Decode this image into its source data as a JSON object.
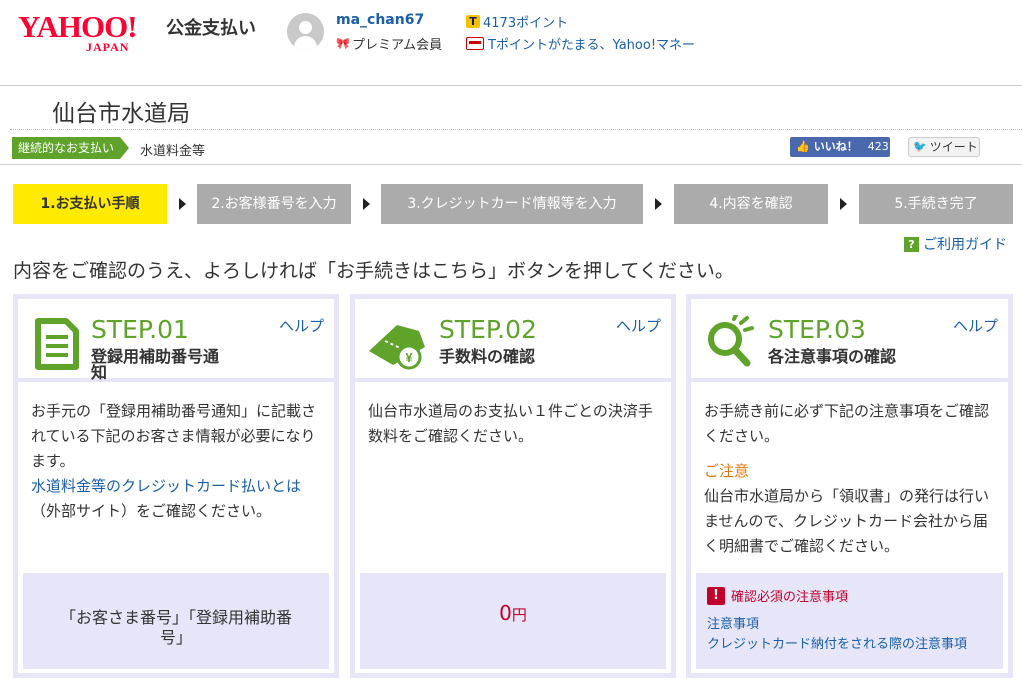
{
  "header": {
    "logo_text": "YAHOO!",
    "logo_sub": "JAPAN",
    "service_name": "公金支払い",
    "username": "ma_chan67",
    "membership": "プレミアム会員",
    "points": "4173ポイント",
    "tpoint_link": "Tポイントがたまる、Yahoo!マネー"
  },
  "page": {
    "title": "仙台市水道局",
    "tag": "継続的なお支払い",
    "category": "水道料金等",
    "like_label": "いいね！",
    "like_count": "423",
    "tweet_label": "ツイート"
  },
  "steps": [
    {
      "label": "1.お支払い手順",
      "active": true
    },
    {
      "label": "2.お客様番号を入力",
      "active": false
    },
    {
      "label": "3.クレジットカード情報等を入力",
      "active": false
    },
    {
      "label": "4.内容を確認",
      "active": false
    },
    {
      "label": "5.手続き完了",
      "active": false
    }
  ],
  "guide_link": "ご利用ガイド",
  "instruction": "内容をご確認のうえ、よろしければ「お手続きはこちら」ボタンを押してください。",
  "cards": {
    "step1": {
      "label": "STEP.01",
      "title_line1": "登録用補助番号通",
      "title_line2": "知",
      "help": "ヘルプ",
      "body_text": "お手元の「登録用補助番号通知」に記載されている下記のお客さま情報が必要になります。",
      "body_link": "水道料金等のクレジットカード払いとは",
      "body_suffix": "（外部サイト）をご確認ください。",
      "foot_line1": "「お客さま番号」「登録用補助番",
      "foot_line2": "号」"
    },
    "step2": {
      "label": "STEP.02",
      "title": "手数料の確認",
      "help": "ヘルプ",
      "body_text": "仙台市水道局のお支払い１件ごとの決済手数料をご確認ください。",
      "fee_value": "0",
      "fee_unit": "円"
    },
    "step3": {
      "label": "STEP.03",
      "title": "各注意事項の確認",
      "help": "ヘルプ",
      "body_text": "お手続き前に必ず下記の注意事項をご確認ください。",
      "caution_label": "ご注意",
      "caution_text": "仙台市水道局から「領収書」の発行は行いませんので、クレジットカード会社から届く明細書でご確認ください。",
      "notice_title": "確認必須の注意事項",
      "notice_link1": "注意事項",
      "notice_link2": "クレジットカード納付をされる際の注意事項"
    }
  },
  "colors": {
    "brand_red": "#ff0033",
    "green": "#5fa32a",
    "active_step": "#ffea00",
    "inactive_step": "#ababab",
    "link": "#1a5fa8",
    "fee_red": "#c0002b"
  }
}
